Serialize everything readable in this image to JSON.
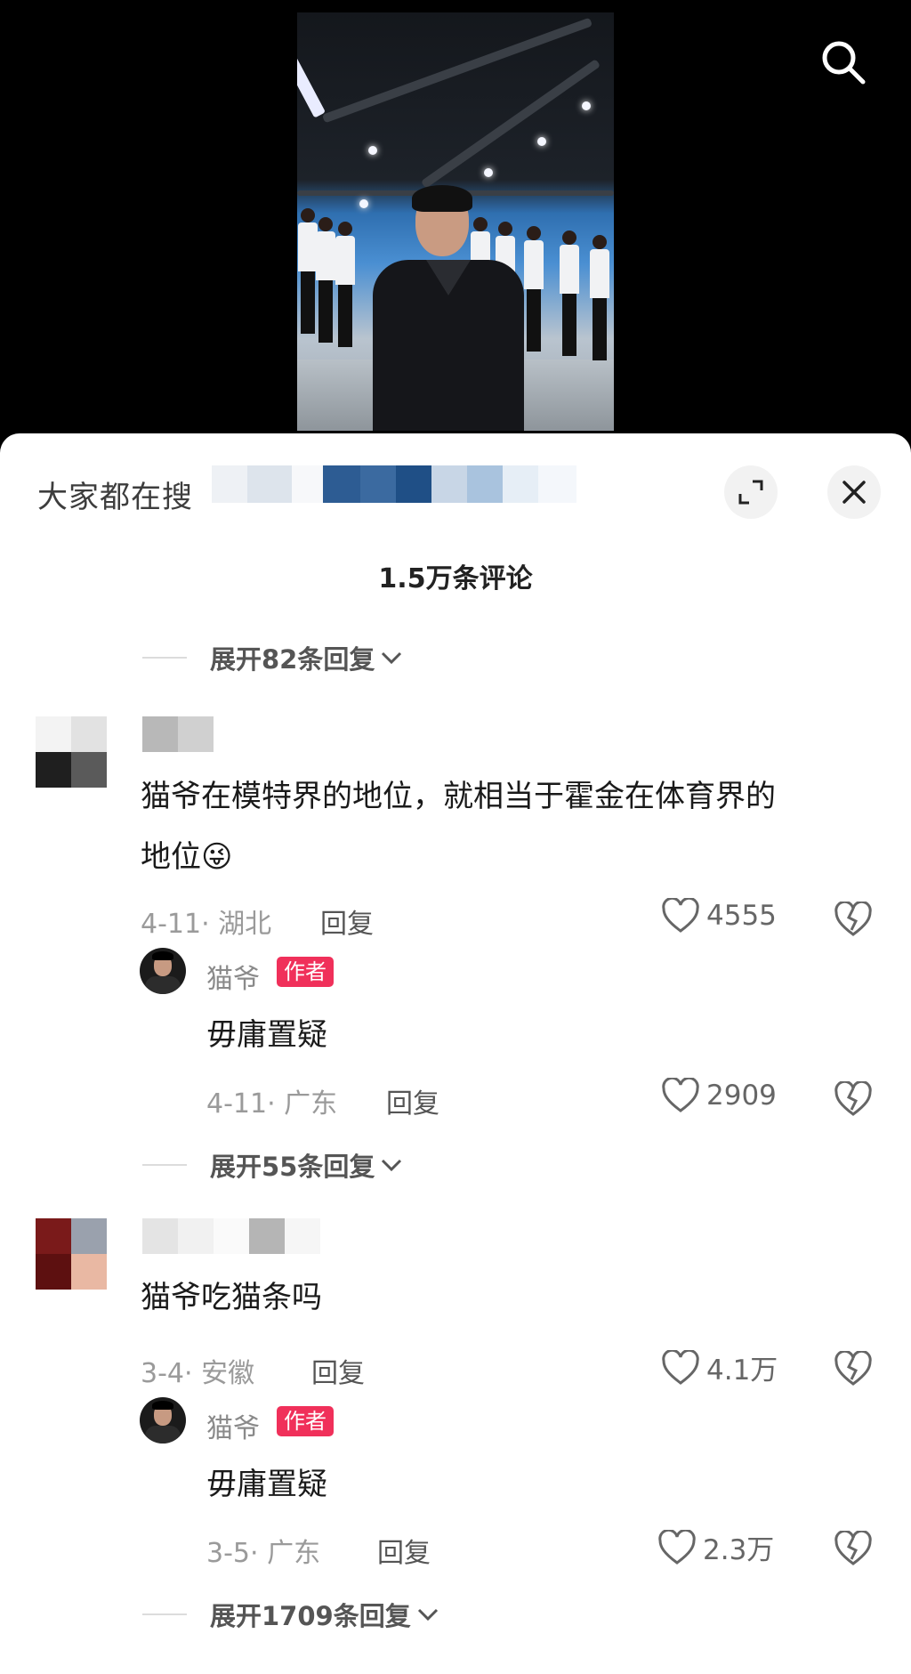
{
  "search": {
    "icon": "search-icon"
  },
  "sheet": {
    "search_hint": "大家都在搜",
    "comments_count": "1.5万条评论",
    "icons": {
      "fullscreen": "fullscreen-icon",
      "close": "close-icon"
    }
  },
  "expand_top": "展开82条回复",
  "comments": [
    {
      "text_line1": "猫爷在模特界的地位，就相当于霍金在体育界的",
      "text_line2": "地位😜",
      "date_location": "4-11· 湖北",
      "reply_label": "回复",
      "likes": "4555",
      "reply": {
        "author": "猫爷",
        "badge": "作者",
        "text": "毋庸置疑",
        "date_location": "4-11· 广东",
        "reply_label": "回复",
        "likes": "2909"
      },
      "expand": "展开55条回复"
    },
    {
      "text_line1": "猫爷吃猫条吗",
      "date_location": "3-4· 安徽",
      "reply_label": "回复",
      "likes": "4.1万",
      "reply": {
        "author": "猫爷",
        "badge": "作者",
        "text": "毋庸置疑",
        "date_location": "3-5· 广东",
        "reply_label": "回复",
        "likes": "2.3万"
      },
      "expand": "展开1709条回复"
    }
  ]
}
